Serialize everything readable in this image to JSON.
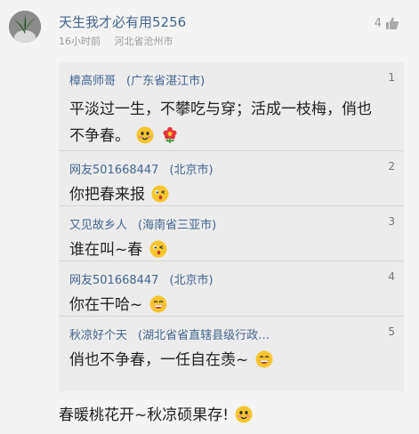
{
  "comment": {
    "username": "天生我才必有用5256",
    "time": "16小时前",
    "location": "河北省沧州市",
    "likes": "4",
    "text": "春暖桃花开~秋凉硕果存!"
  },
  "replies": [
    {
      "user": "樟高师哥",
      "location": "(广东省湛江市)",
      "num": "1",
      "text": "平淡过一生，不攀吃与穿；活成一枝梅，俏也不争春。",
      "emojis": [
        "smile-emoji",
        "flower-emoji"
      ]
    },
    {
      "user": "网友501668447",
      "location": "(北京市)",
      "num": "2",
      "text": "你把春来报",
      "emojis": [
        "kiss-emoji"
      ]
    },
    {
      "user": "又见故乡人",
      "location": "(海南省三亚市)",
      "num": "3",
      "text": "谁在叫~春",
      "emojis": [
        "kiss-emoji"
      ]
    },
    {
      "user": "网友501668447",
      "location": "(北京市)",
      "num": "4",
      "text": "你在干哈~",
      "emojis": [
        "grin-emoji"
      ]
    },
    {
      "user": "秋凉好个天",
      "location": "(湖北省省直辖县级行政…",
      "num": "5",
      "text": "俏也不争春，一任自在羡~",
      "emojis": [
        "grin-emoji"
      ]
    }
  ]
}
